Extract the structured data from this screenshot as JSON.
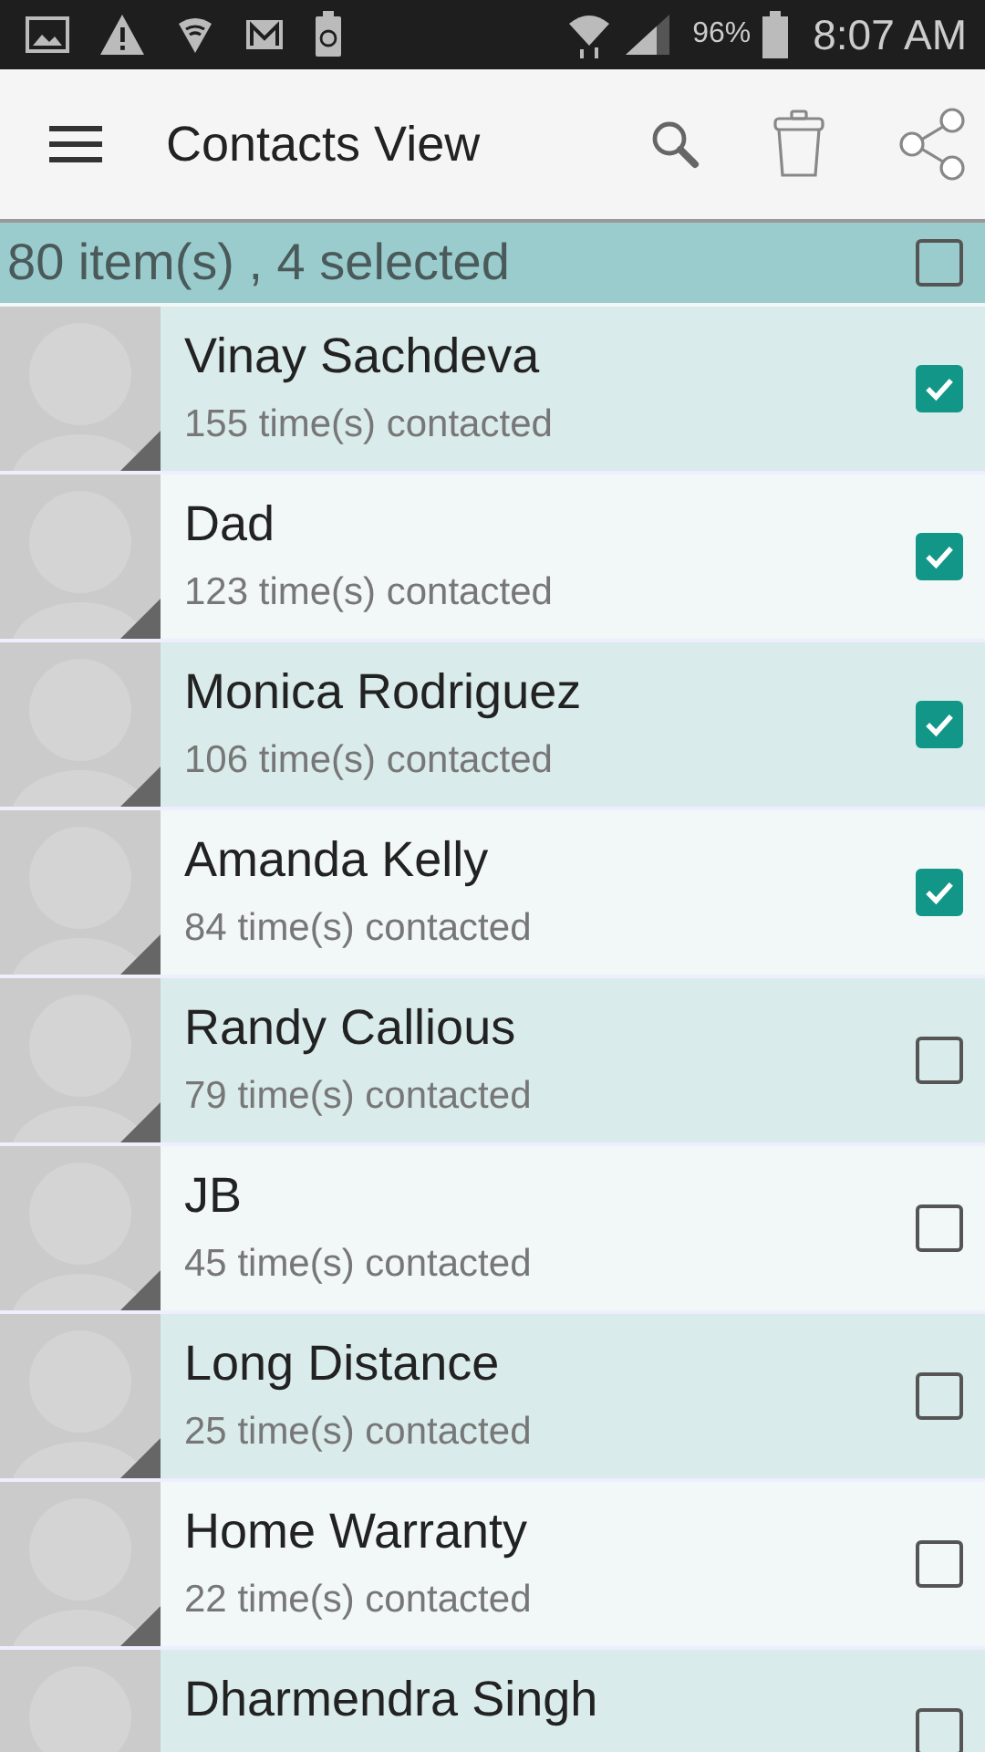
{
  "status_bar": {
    "battery_percent": "96%",
    "time": "8:07 AM"
  },
  "toolbar": {
    "title": "Contacts View"
  },
  "selection_header": {
    "summary": "80 item(s) , 4 selected",
    "checked": false
  },
  "contacts": [
    {
      "name": "Vinay Sachdeva",
      "contacted": "155 time(s) contacted",
      "checked": true
    },
    {
      "name": "Dad",
      "contacted": "123 time(s) contacted",
      "checked": true
    },
    {
      "name": "Monica Rodriguez",
      "contacted": "106 time(s) contacted",
      "checked": true
    },
    {
      "name": "Amanda Kelly",
      "contacted": "84 time(s) contacted",
      "checked": true
    },
    {
      "name": "Randy Callious",
      "contacted": "79 time(s) contacted",
      "checked": false
    },
    {
      "name": "JB",
      "contacted": "45 time(s) contacted",
      "checked": false
    },
    {
      "name": "Long Distance",
      "contacted": "25 time(s) contacted",
      "checked": false
    },
    {
      "name": "Home Warranty",
      "contacted": "22 time(s) contacted",
      "checked": false
    },
    {
      "name": "Dharmendra Singh",
      "checked": false
    }
  ]
}
